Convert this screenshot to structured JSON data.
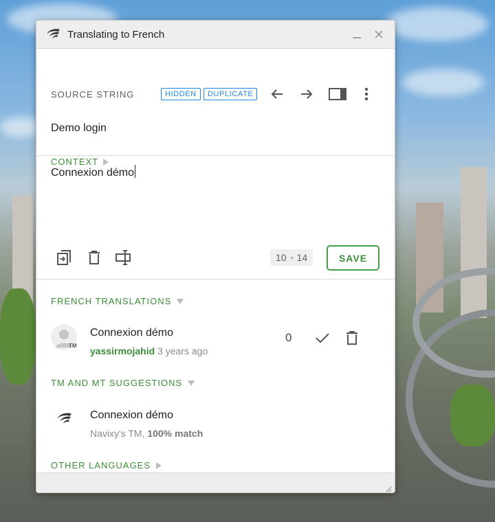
{
  "window": {
    "title": "Translating to French"
  },
  "source": {
    "label": "SOURCE STRING",
    "badges": [
      "HIDDEN",
      "DUPLICATE"
    ],
    "text": "Demo login",
    "context_label": "CONTEXT"
  },
  "editor": {
    "value": "Connexion démo",
    "counter_current": "10",
    "counter_source": "14",
    "save_label": "SAVE"
  },
  "translations": {
    "section_label": "FRENCH TRANSLATIONS",
    "items": [
      {
        "text": "Connexion démo",
        "author": "yassirmojahid",
        "age": "3 years ago",
        "votes": "0",
        "avatar_badge": "TM"
      }
    ]
  },
  "suggestions": {
    "section_label": "TM AND MT SUGGESTIONS",
    "items": [
      {
        "text": "Connexion démo",
        "source": "Navixy's TM,",
        "match": "100% match"
      }
    ]
  },
  "other_languages": {
    "label": "OTHER LANGUAGES"
  },
  "colors": {
    "accent_green": "#3c8f37",
    "badge_blue": "#1e88e5"
  },
  "icons": {
    "titlebar": [
      "crowdin-logo-icon",
      "minimize-icon",
      "close-icon"
    ],
    "toolbar": [
      "arrow-left-icon",
      "arrow-right-icon",
      "split-view-icon",
      "more-vert-icon"
    ],
    "editor": [
      "copy-source-icon",
      "delete-icon",
      "text-cursor-icon"
    ],
    "translation": [
      "check-icon",
      "delete-icon"
    ]
  }
}
